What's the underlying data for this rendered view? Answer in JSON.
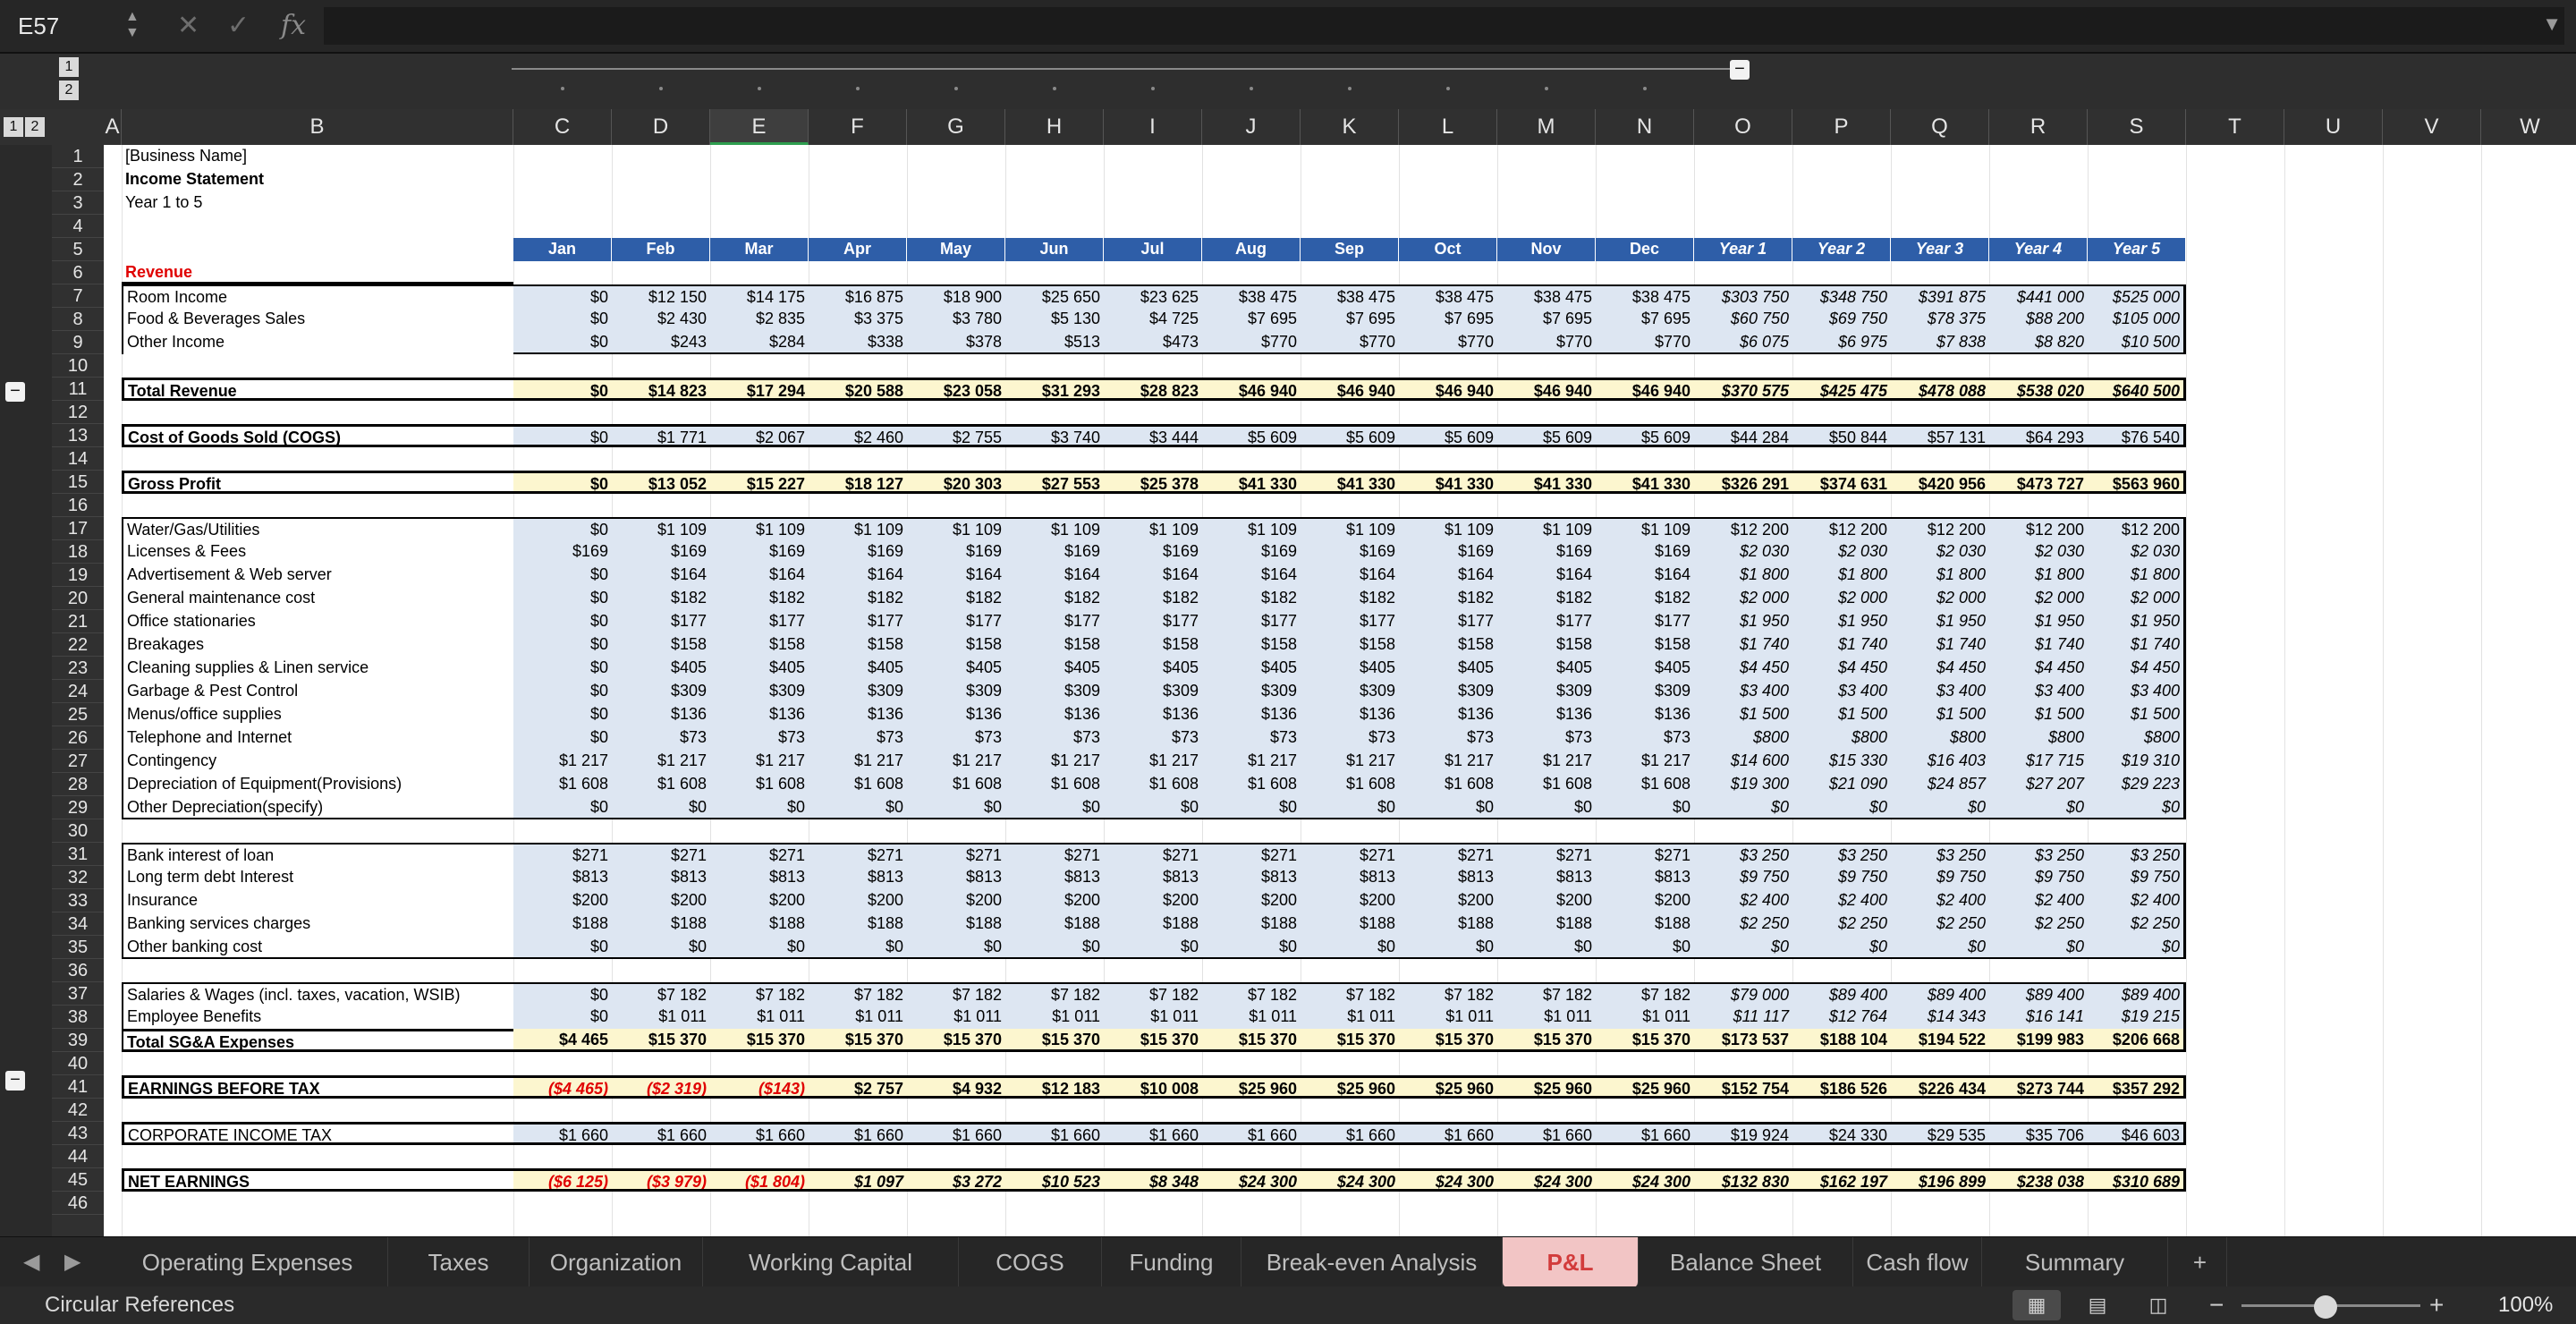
{
  "formula_bar": {
    "cell_ref": "E57",
    "cancel_icon": "✕",
    "confirm_icon": "✓",
    "fx_label": "fx",
    "content": ""
  },
  "outline": {
    "levels": [
      "1",
      "2"
    ],
    "col_levels": [
      "1",
      "2"
    ]
  },
  "columns": [
    "A",
    "B",
    "C",
    "D",
    "E",
    "F",
    "G",
    "H",
    "I",
    "J",
    "K",
    "L",
    "M",
    "N",
    "O",
    "P",
    "Q",
    "R",
    "S",
    "T",
    "U",
    "V",
    "W"
  ],
  "selected_column": "E",
  "header_cells": [
    "Jan",
    "Feb",
    "Mar",
    "Apr",
    "May",
    "Jun",
    "Jul",
    "Aug",
    "Sep",
    "Oct",
    "Nov",
    "Dec",
    "Year 1",
    "Year 2",
    "Year 3",
    "Year 4",
    "Year 5"
  ],
  "rows": [
    {
      "n": "1",
      "label": "[Business Name]"
    },
    {
      "n": "2",
      "label": "Income Statement"
    },
    {
      "n": "3",
      "label": "Year 1 to 5"
    },
    {
      "n": "4",
      "label": ""
    },
    {
      "n": "5",
      "label": ""
    },
    {
      "n": "6",
      "label": "Revenue"
    },
    {
      "n": "7",
      "label": "Room Income",
      "v": [
        "$0",
        "$12 150",
        "$14 175",
        "$16 875",
        "$18 900",
        "$25 650",
        "$23 625",
        "$38 475",
        "$38 475",
        "$38 475",
        "$38 475",
        "$38 475",
        "$303 750",
        "$348 750",
        "$391 875",
        "$441 000",
        "$525 000"
      ]
    },
    {
      "n": "8",
      "label": "Food & Beverages Sales",
      "v": [
        "$0",
        "$2 430",
        "$2 835",
        "$3 375",
        "$3 780",
        "$5 130",
        "$4 725",
        "$7 695",
        "$7 695",
        "$7 695",
        "$7 695",
        "$7 695",
        "$60 750",
        "$69 750",
        "$78 375",
        "$88 200",
        "$105 000"
      ]
    },
    {
      "n": "9",
      "label": "Other Income",
      "v": [
        "$0",
        "$243",
        "$284",
        "$338",
        "$378",
        "$513",
        "$473",
        "$770",
        "$770",
        "$770",
        "$770",
        "$770",
        "$6 075",
        "$6 975",
        "$7 838",
        "$8 820",
        "$10 500"
      ]
    },
    {
      "n": "10",
      "label": ""
    },
    {
      "n": "11",
      "label": "Total Revenue",
      "v": [
        "$0",
        "$14 823",
        "$17 294",
        "$20 588",
        "$23 058",
        "$31 293",
        "$28 823",
        "$46 940",
        "$46 940",
        "$46 940",
        "$46 940",
        "$46 940",
        "$370 575",
        "$425 475",
        "$478 088",
        "$538 020",
        "$640 500"
      ]
    },
    {
      "n": "12",
      "label": ""
    },
    {
      "n": "13",
      "label": "Cost of Goods Sold (COGS)",
      "v": [
        "$0",
        "$1 771",
        "$2 067",
        "$2 460",
        "$2 755",
        "$3 740",
        "$3 444",
        "$5 609",
        "$5 609",
        "$5 609",
        "$5 609",
        "$5 609",
        "$44 284",
        "$50 844",
        "$57 131",
        "$64 293",
        "$76 540"
      ]
    },
    {
      "n": "14",
      "label": ""
    },
    {
      "n": "15",
      "label": "Gross Profit",
      "v": [
        "$0",
        "$13 052",
        "$15 227",
        "$18 127",
        "$20 303",
        "$27 553",
        "$25 378",
        "$41 330",
        "$41 330",
        "$41 330",
        "$41 330",
        "$41 330",
        "$326 291",
        "$374 631",
        "$420 956",
        "$473 727",
        "$563 960"
      ]
    },
    {
      "n": "16",
      "label": ""
    },
    {
      "n": "17",
      "label": "Water/Gas/Utilities",
      "v": [
        "$0",
        "$1 109",
        "$1 109",
        "$1 109",
        "$1 109",
        "$1 109",
        "$1 109",
        "$1 109",
        "$1 109",
        "$1 109",
        "$1 109",
        "$1 109",
        "$12 200",
        "$12 200",
        "$12 200",
        "$12 200",
        "$12 200"
      ]
    },
    {
      "n": "18",
      "label": "Licenses & Fees",
      "v": [
        "$169",
        "$169",
        "$169",
        "$169",
        "$169",
        "$169",
        "$169",
        "$169",
        "$169",
        "$169",
        "$169",
        "$169",
        "$2 030",
        "$2 030",
        "$2 030",
        "$2 030",
        "$2 030"
      ]
    },
    {
      "n": "19",
      "label": "Advertisement & Web server",
      "v": [
        "$0",
        "$164",
        "$164",
        "$164",
        "$164",
        "$164",
        "$164",
        "$164",
        "$164",
        "$164",
        "$164",
        "$164",
        "$1 800",
        "$1 800",
        "$1 800",
        "$1 800",
        "$1 800"
      ]
    },
    {
      "n": "20",
      "label": "General maintenance cost",
      "v": [
        "$0",
        "$182",
        "$182",
        "$182",
        "$182",
        "$182",
        "$182",
        "$182",
        "$182",
        "$182",
        "$182",
        "$182",
        "$2 000",
        "$2 000",
        "$2 000",
        "$2 000",
        "$2 000"
      ]
    },
    {
      "n": "21",
      "label": "Office stationaries",
      "v": [
        "$0",
        "$177",
        "$177",
        "$177",
        "$177",
        "$177",
        "$177",
        "$177",
        "$177",
        "$177",
        "$177",
        "$177",
        "$1 950",
        "$1 950",
        "$1 950",
        "$1 950",
        "$1 950"
      ]
    },
    {
      "n": "22",
      "label": "Breakages",
      "v": [
        "$0",
        "$158",
        "$158",
        "$158",
        "$158",
        "$158",
        "$158",
        "$158",
        "$158",
        "$158",
        "$158",
        "$158",
        "$1 740",
        "$1 740",
        "$1 740",
        "$1 740",
        "$1 740"
      ]
    },
    {
      "n": "23",
      "label": "Cleaning supplies & Linen service",
      "v": [
        "$0",
        "$405",
        "$405",
        "$405",
        "$405",
        "$405",
        "$405",
        "$405",
        "$405",
        "$405",
        "$405",
        "$405",
        "$4 450",
        "$4 450",
        "$4 450",
        "$4 450",
        "$4 450"
      ]
    },
    {
      "n": "24",
      "label": "Garbage & Pest Control",
      "v": [
        "$0",
        "$309",
        "$309",
        "$309",
        "$309",
        "$309",
        "$309",
        "$309",
        "$309",
        "$309",
        "$309",
        "$309",
        "$3 400",
        "$3 400",
        "$3 400",
        "$3 400",
        "$3 400"
      ]
    },
    {
      "n": "25",
      "label": "Menus/office supplies",
      "v": [
        "$0",
        "$136",
        "$136",
        "$136",
        "$136",
        "$136",
        "$136",
        "$136",
        "$136",
        "$136",
        "$136",
        "$136",
        "$1 500",
        "$1 500",
        "$1 500",
        "$1 500",
        "$1 500"
      ]
    },
    {
      "n": "26",
      "label": "Telephone and Internet",
      "v": [
        "$0",
        "$73",
        "$73",
        "$73",
        "$73",
        "$73",
        "$73",
        "$73",
        "$73",
        "$73",
        "$73",
        "$73",
        "$800",
        "$800",
        "$800",
        "$800",
        "$800"
      ]
    },
    {
      "n": "27",
      "label": "Contingency",
      "v": [
        "$1 217",
        "$1 217",
        "$1 217",
        "$1 217",
        "$1 217",
        "$1 217",
        "$1 217",
        "$1 217",
        "$1 217",
        "$1 217",
        "$1 217",
        "$1 217",
        "$14 600",
        "$15 330",
        "$16 403",
        "$17 715",
        "$19 310"
      ]
    },
    {
      "n": "28",
      "label": "Depreciation of Equipment(Provisions)",
      "v": [
        "$1 608",
        "$1 608",
        "$1 608",
        "$1 608",
        "$1 608",
        "$1 608",
        "$1 608",
        "$1 608",
        "$1 608",
        "$1 608",
        "$1 608",
        "$1 608",
        "$19 300",
        "$21 090",
        "$24 857",
        "$27 207",
        "$29 223"
      ]
    },
    {
      "n": "29",
      "label": "Other Depreciation(specify)",
      "v": [
        "$0",
        "$0",
        "$0",
        "$0",
        "$0",
        "$0",
        "$0",
        "$0",
        "$0",
        "$0",
        "$0",
        "$0",
        "$0",
        "$0",
        "$0",
        "$0",
        "$0"
      ]
    },
    {
      "n": "30",
      "label": ""
    },
    {
      "n": "31",
      "label": "Bank interest of loan",
      "v": [
        "$271",
        "$271",
        "$271",
        "$271",
        "$271",
        "$271",
        "$271",
        "$271",
        "$271",
        "$271",
        "$271",
        "$271",
        "$3 250",
        "$3 250",
        "$3 250",
        "$3 250",
        "$3 250"
      ]
    },
    {
      "n": "32",
      "label": "Long term debt Interest",
      "v": [
        "$813",
        "$813",
        "$813",
        "$813",
        "$813",
        "$813",
        "$813",
        "$813",
        "$813",
        "$813",
        "$813",
        "$813",
        "$9 750",
        "$9 750",
        "$9 750",
        "$9 750",
        "$9 750"
      ]
    },
    {
      "n": "33",
      "label": "Insurance",
      "v": [
        "$200",
        "$200",
        "$200",
        "$200",
        "$200",
        "$200",
        "$200",
        "$200",
        "$200",
        "$200",
        "$200",
        "$200",
        "$2 400",
        "$2 400",
        "$2 400",
        "$2 400",
        "$2 400"
      ]
    },
    {
      "n": "34",
      "label": "Banking services charges",
      "v": [
        "$188",
        "$188",
        "$188",
        "$188",
        "$188",
        "$188",
        "$188",
        "$188",
        "$188",
        "$188",
        "$188",
        "$188",
        "$2 250",
        "$2 250",
        "$2 250",
        "$2 250",
        "$2 250"
      ]
    },
    {
      "n": "35",
      "label": "Other banking cost",
      "v": [
        "$0",
        "$0",
        "$0",
        "$0",
        "$0",
        "$0",
        "$0",
        "$0",
        "$0",
        "$0",
        "$0",
        "$0",
        "$0",
        "$0",
        "$0",
        "$0",
        "$0"
      ]
    },
    {
      "n": "36",
      "label": ""
    },
    {
      "n": "37",
      "label": "Salaries & Wages (incl. taxes, vacation, WSIB)",
      "v": [
        "$0",
        "$7 182",
        "$7 182",
        "$7 182",
        "$7 182",
        "$7 182",
        "$7 182",
        "$7 182",
        "$7 182",
        "$7 182",
        "$7 182",
        "$7 182",
        "$79 000",
        "$89 400",
        "$89 400",
        "$89 400",
        "$89 400"
      ]
    },
    {
      "n": "38",
      "label": "Employee Benefits",
      "v": [
        "$0",
        "$1 011",
        "$1 011",
        "$1 011",
        "$1 011",
        "$1 011",
        "$1 011",
        "$1 011",
        "$1 011",
        "$1 011",
        "$1 011",
        "$1 011",
        "$11 117",
        "$12 764",
        "$14 343",
        "$16 141",
        "$19 215"
      ]
    },
    {
      "n": "39",
      "label": "Total  SG&A Expenses",
      "v": [
        "$4 465",
        "$15 370",
        "$15 370",
        "$15 370",
        "$15 370",
        "$15 370",
        "$15 370",
        "$15 370",
        "$15 370",
        "$15 370",
        "$15 370",
        "$15 370",
        "$173 537",
        "$188 104",
        "$194 522",
        "$199 983",
        "$206 668"
      ]
    },
    {
      "n": "40",
      "label": ""
    },
    {
      "n": "41",
      "label": "EARNINGS BEFORE TAX",
      "v": [
        "($4 465)",
        "($2 319)",
        "($143)",
        "$2 757",
        "$4 932",
        "$12 183",
        "$10 008",
        "$25 960",
        "$25 960",
        "$25 960",
        "$25 960",
        "$25 960",
        "$152 754",
        "$186 526",
        "$226 434",
        "$273 744",
        "$357 292"
      ]
    },
    {
      "n": "42",
      "label": ""
    },
    {
      "n": "43",
      "label": "CORPORATE INCOME TAX",
      "v": [
        "$1 660",
        "$1 660",
        "$1 660",
        "$1 660",
        "$1 660",
        "$1 660",
        "$1 660",
        "$1 660",
        "$1 660",
        "$1 660",
        "$1 660",
        "$1 660",
        "$19 924",
        "$24 330",
        "$29 535",
        "$35 706",
        "$46 603"
      ]
    },
    {
      "n": "44",
      "label": ""
    },
    {
      "n": "45",
      "label": "NET EARNINGS",
      "v": [
        "($6 125)",
        "($3 979)",
        "($1 804)",
        "$1 097",
        "$3 272",
        "$10 523",
        "$8 348",
        "$24 300",
        "$24 300",
        "$24 300",
        "$24 300",
        "$24 300",
        "$132 830",
        "$162 197",
        "$196 899",
        "$238 038",
        "$310 689"
      ]
    },
    {
      "n": "46",
      "label": ""
    }
  ],
  "tabs": [
    "Operating Expenses",
    "Taxes",
    "Organization",
    "Working Capital",
    "COGS",
    "Funding",
    "Break-even Analysis",
    "P&L",
    "Balance Sheet",
    "Cash flow",
    "Summary"
  ],
  "active_tab": "P&L",
  "add_tab": "+",
  "status": {
    "text": "Circular References",
    "zoom_minus": "−",
    "zoom_plus": "+",
    "zoom": "100%"
  },
  "colors": {
    "header_blue": "#2e5ea8",
    "input_blue": "#dde6f2",
    "total_yellow": "#fcf6cf",
    "negative_red": "#e00000",
    "revenue_red": "#e00000",
    "active_tab_bg": "#f2c5c5"
  }
}
